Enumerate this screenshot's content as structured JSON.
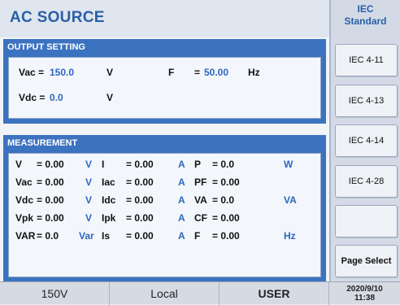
{
  "header": {
    "title": "AC SOURCE"
  },
  "output": {
    "title": "OUTPUT SETTING",
    "vac_label": "Vac =",
    "vac_value": "150.0",
    "vac_unit": "V",
    "f_label": "F",
    "f_eq": "=",
    "f_value": "50.00",
    "f_unit": "Hz",
    "vdc_label": "Vdc =",
    "vdc_value": "0.0",
    "vdc_unit": "V"
  },
  "measurement": {
    "title": "MEASUREMENT",
    "rows": [
      {
        "a_label": "V",
        "a_value": "= 0.00",
        "a_unit": "V",
        "b_label": "I",
        "b_value": "= 0.00",
        "b_unit": "A",
        "c_label": "P",
        "c_value": "= 0.0",
        "c_unit": "W"
      },
      {
        "a_label": "Vac",
        "a_value": "= 0.00",
        "a_unit": "V",
        "b_label": "Iac",
        "b_value": "= 0.00",
        "b_unit": "A",
        "c_label": "PF",
        "c_value": "= 0.00",
        "c_unit": ""
      },
      {
        "a_label": "Vdc",
        "a_value": "= 0.00",
        "a_unit": "V",
        "b_label": "Idc",
        "b_value": "= 0.00",
        "b_unit": "A",
        "c_label": "VA",
        "c_value": "= 0.0",
        "c_unit": "VA"
      },
      {
        "a_label": "Vpk",
        "a_value": "= 0.00",
        "a_unit": "V",
        "b_label": "Ipk",
        "b_value": "= 0.00",
        "b_unit": "A",
        "c_label": "CF",
        "c_value": "= 0.00",
        "c_unit": ""
      },
      {
        "a_label": "VAR",
        "a_value": "= 0.0",
        "a_unit": "Var",
        "b_label": "Is",
        "b_value": "= 0.00",
        "b_unit": "A",
        "c_label": "F",
        "c_value": "= 0.00",
        "c_unit": "Hz"
      }
    ]
  },
  "sidebar": {
    "title_line1": "IEC",
    "title_line2": "Standard",
    "buttons": [
      "IEC 4-11",
      "IEC 4-13",
      "IEC 4-14",
      "IEC 4-28",
      "",
      "Page Select"
    ]
  },
  "status": {
    "voltage": "150V",
    "mode": "Local",
    "user": "USER",
    "date": "2020/9/10",
    "time": "11:38"
  }
}
